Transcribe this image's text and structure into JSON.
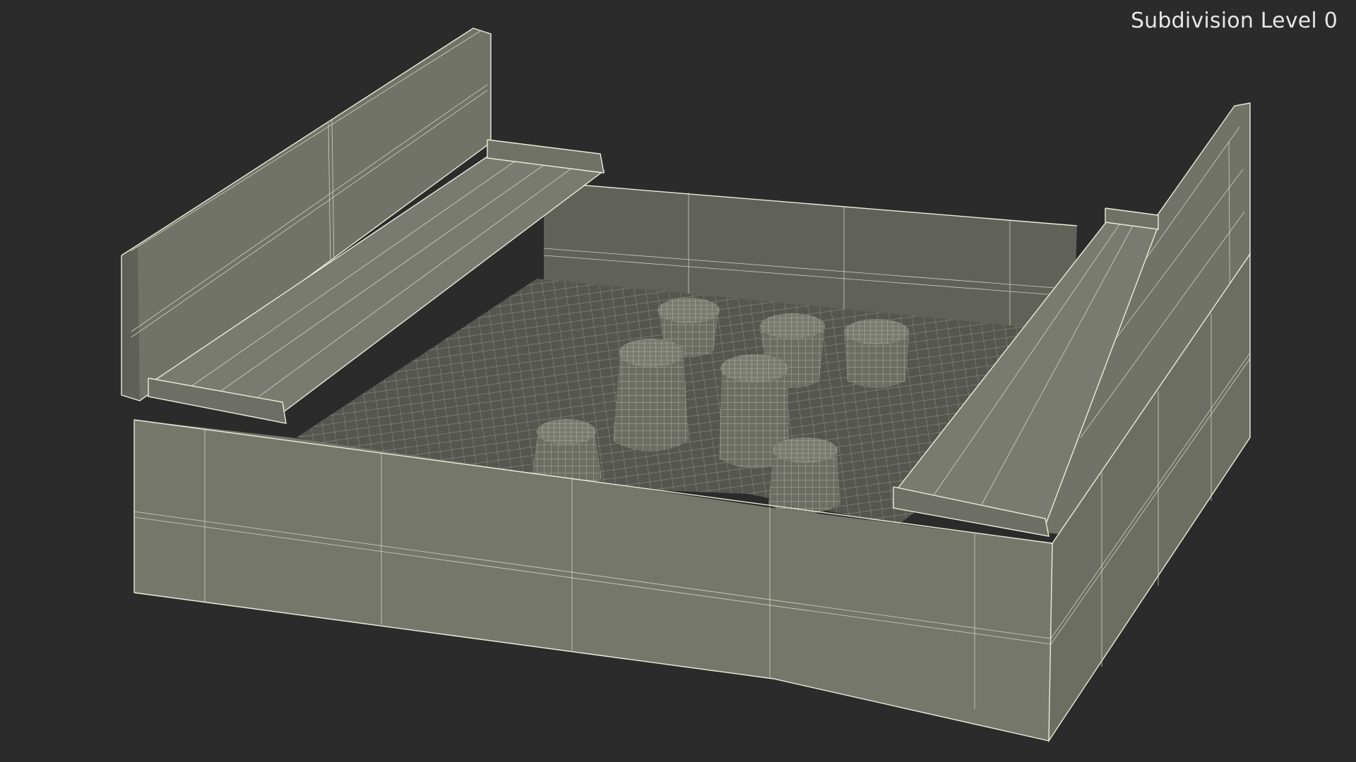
{
  "viewport": {
    "label": "Subdivision Level 0"
  },
  "colors": {
    "background": "#2b2b2b",
    "surface": "#77786c",
    "surface_dark": "#65665c",
    "sand": "#55564f",
    "wireframe": "#ececd8"
  }
}
